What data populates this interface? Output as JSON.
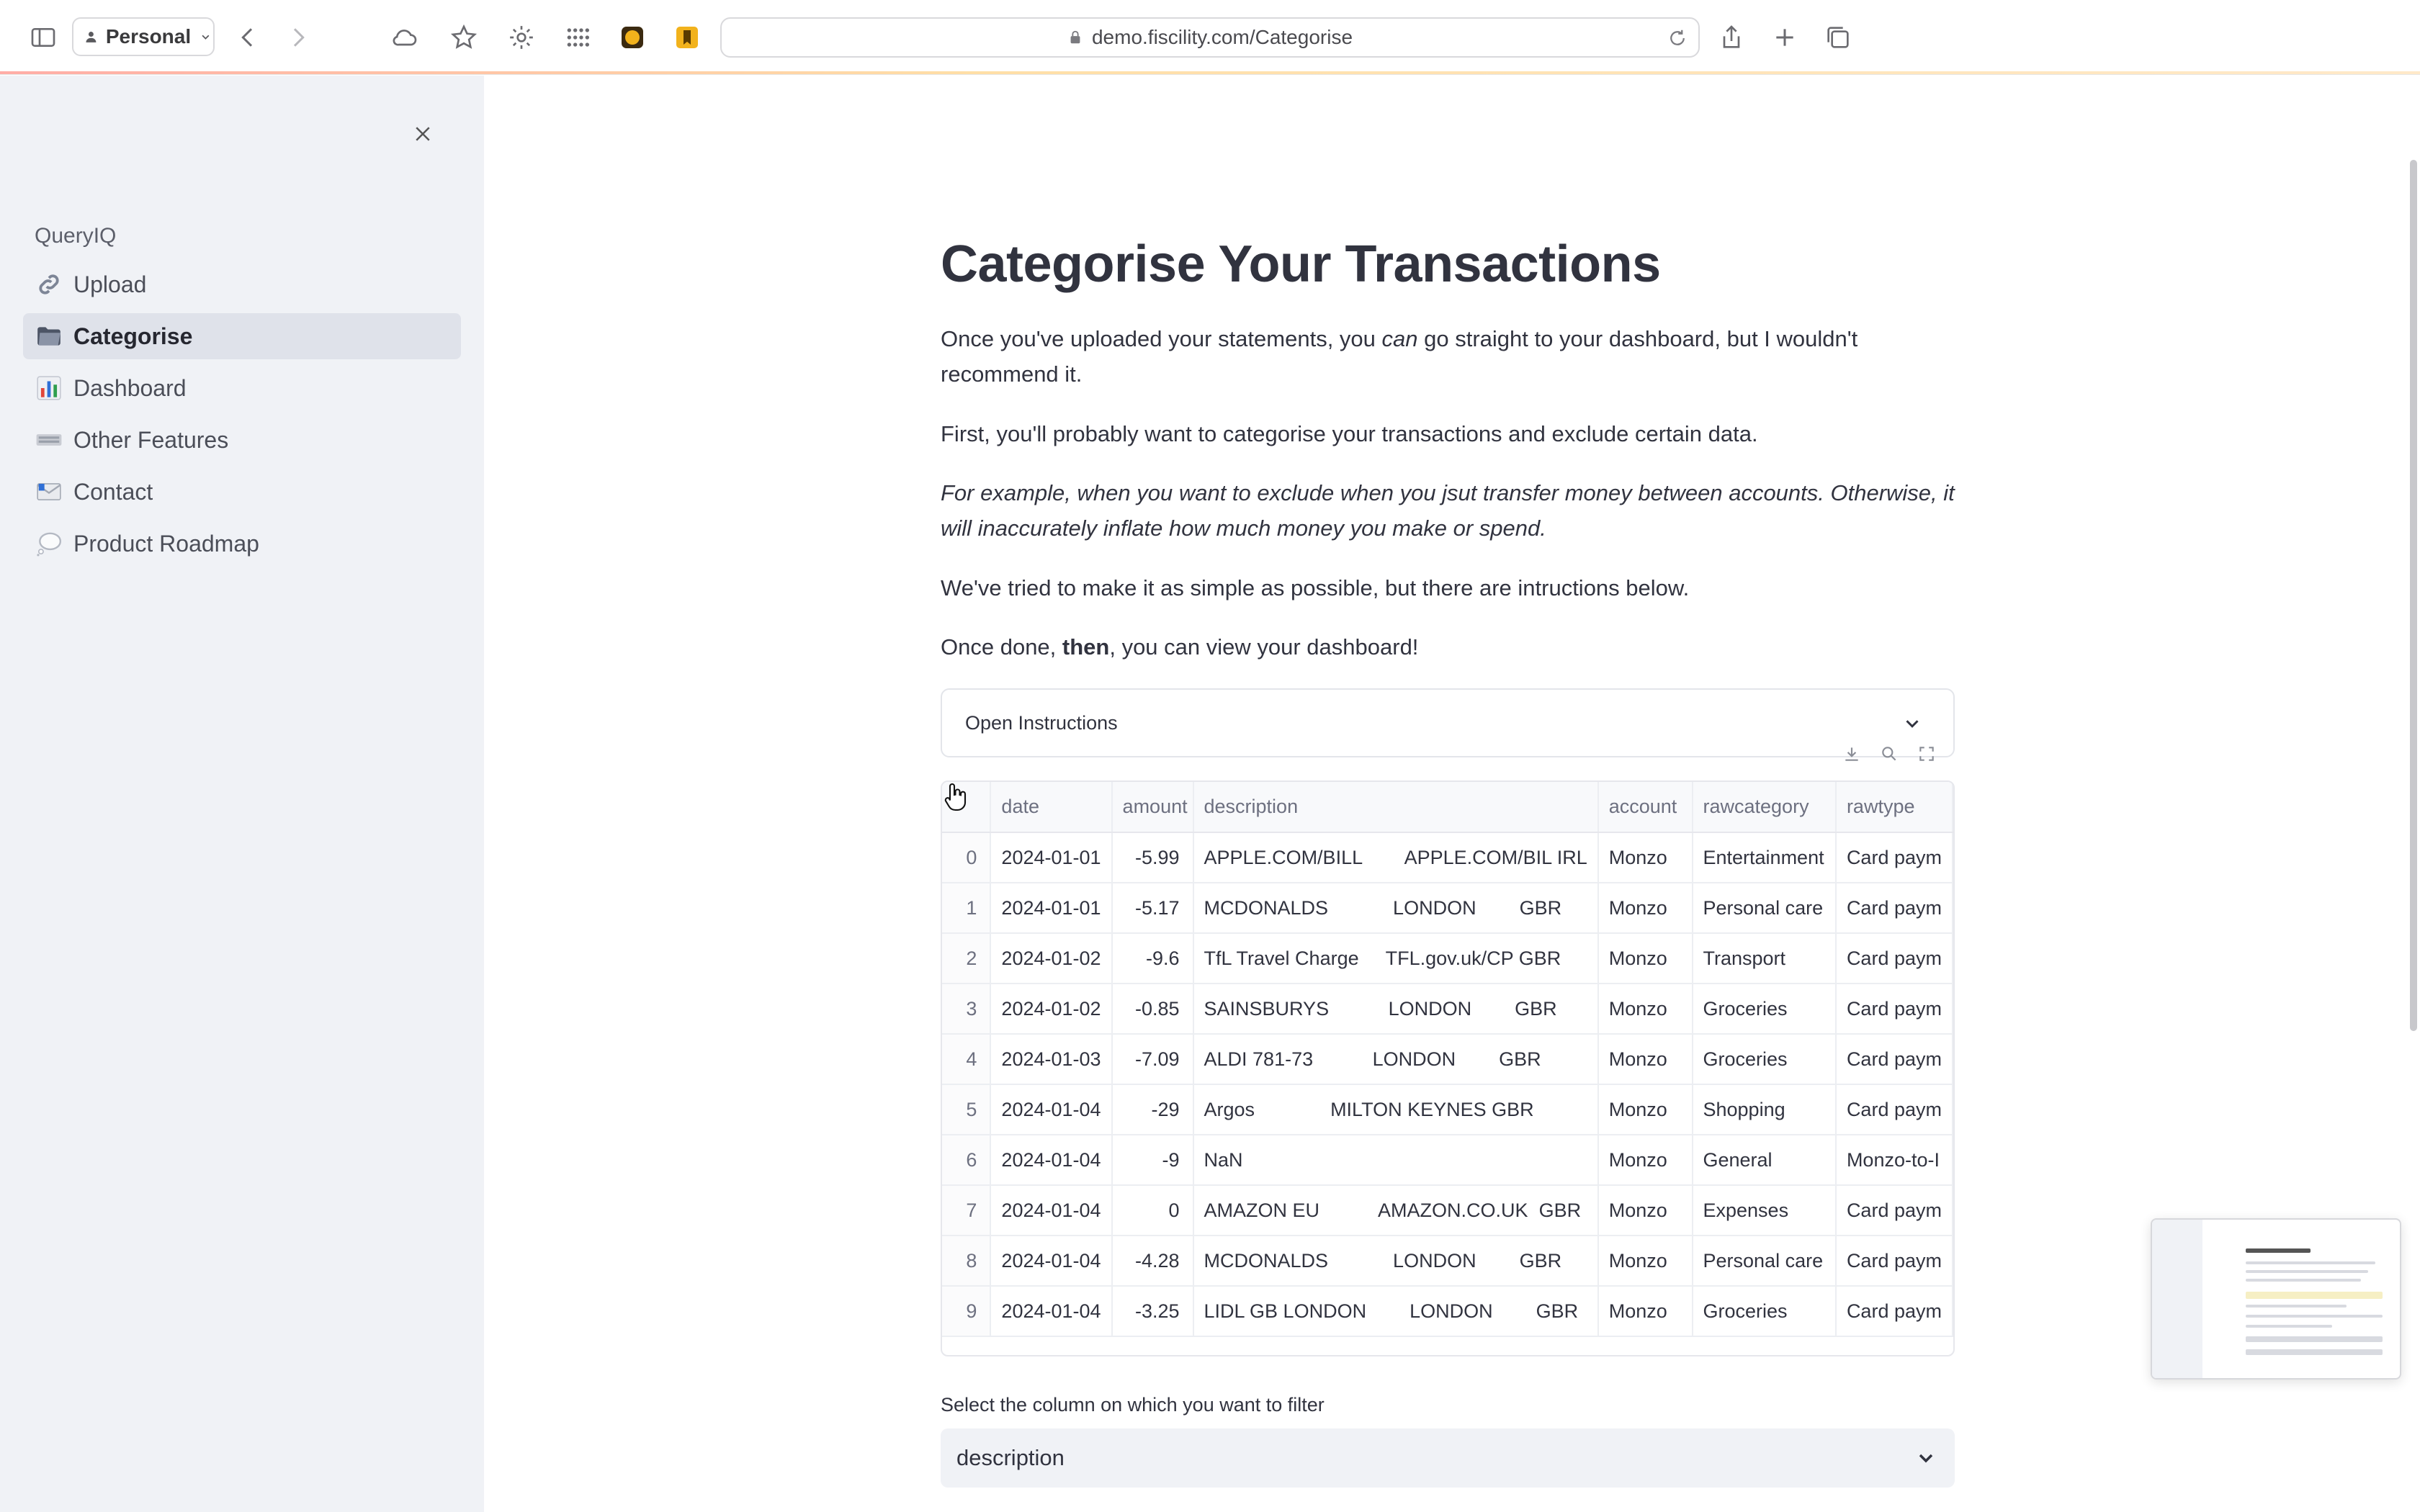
{
  "browser": {
    "profile": "Personal",
    "url": "demo.fiscility.com/Categorise"
  },
  "sidebar": {
    "app_name": "QueryIQ",
    "items": [
      {
        "label": "Upload",
        "icon": "link-icon",
        "active": false
      },
      {
        "label": "Categorise",
        "icon": "folder-icon",
        "active": true
      },
      {
        "label": "Dashboard",
        "icon": "bar-chart-icon",
        "active": false
      },
      {
        "label": "Other Features",
        "icon": "keyboard-icon",
        "active": false
      },
      {
        "label": "Contact",
        "icon": "email-icon",
        "active": false
      },
      {
        "label": "Product Roadmap",
        "icon": "thought-bubble-icon",
        "active": false
      }
    ]
  },
  "main": {
    "title": "Categorise Your Transactions",
    "p1_a": "Once you've uploaded your statements, you ",
    "p1_em": "can",
    "p1_b": " go straight to your dashboard, but I wouldn't recommend it.",
    "p2": "First, you'll probably want to categorise your transactions and exclude certain data.",
    "p3": "For example, when you want to exclude when you jsut transfer money between accounts. Otherwise, it will inaccurately inflate how much money you make or spend.",
    "p4": "We've tried to make it as simple as possible, but there are intructions below.",
    "p5_a": "Once done, ",
    "p5_strong": "then",
    "p5_b": ", you can view your dashboard!",
    "expander_label": "Open Instructions",
    "filter_label": "Select the column on which you want to filter",
    "filter_value": "description"
  },
  "table": {
    "columns": [
      "",
      "date",
      "amount",
      "description",
      "account",
      "rawcategory",
      "rawtype"
    ],
    "rows": [
      [
        "0",
        "2024-01-01",
        "-5.99",
        "APPLE.COM/BILL        APPLE.COM/BIL IRL",
        "Monzo",
        "Entertainment",
        "Card paym"
      ],
      [
        "1",
        "2024-01-01",
        "-5.17",
        "MCDONALDS            LONDON        GBR",
        "Monzo",
        "Personal care",
        "Card paym"
      ],
      [
        "2",
        "2024-01-02",
        "-9.6",
        "TfL Travel Charge     TFL.gov.uk/CP GBR",
        "Monzo",
        "Transport",
        "Card paym"
      ],
      [
        "3",
        "2024-01-02",
        "-0.85",
        "SAINSBURYS           LONDON        GBR",
        "Monzo",
        "Groceries",
        "Card paym"
      ],
      [
        "4",
        "2024-01-03",
        "-7.09",
        "ALDI 781-73           LONDON        GBR",
        "Monzo",
        "Groceries",
        "Card paym"
      ],
      [
        "5",
        "2024-01-04",
        "-29",
        "Argos              MILTON KEYNES GBR",
        "Monzo",
        "Shopping",
        "Card paym"
      ],
      [
        "6",
        "2024-01-04",
        "-9",
        "NaN",
        "Monzo",
        "General",
        "Monzo-to-I"
      ],
      [
        "7",
        "2024-01-04",
        "0",
        "AMAZON EU           AMAZON.CO.UK  GBR",
        "Monzo",
        "Expenses",
        "Card paym"
      ],
      [
        "8",
        "2024-01-04",
        "-4.28",
        "MCDONALDS            LONDON        GBR",
        "Monzo",
        "Personal care",
        "Card paym"
      ],
      [
        "9",
        "2024-01-04",
        "-3.25",
        "LIDL GB LONDON        LONDON        GBR",
        "Monzo",
        "Groceries",
        "Card paym"
      ]
    ]
  }
}
